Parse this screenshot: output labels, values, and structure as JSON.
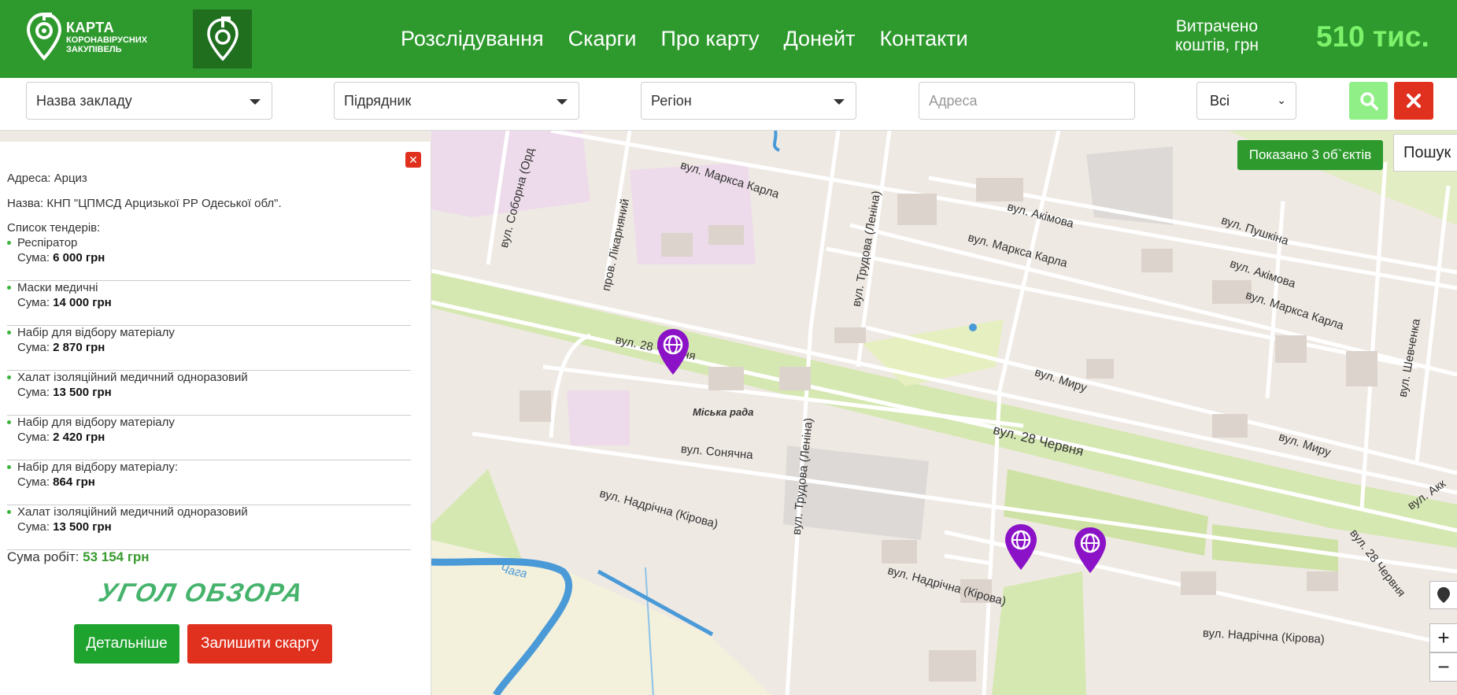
{
  "header": {
    "logo": {
      "line1": "КАРТА",
      "line2": "КОРОНАВІРУСНИХ",
      "line3": "ЗАКУПІВЕЛЬ"
    },
    "nav": [
      "Розслідування",
      "Скарги",
      "Про карту",
      "Донейт",
      "Контакти"
    ],
    "spent_label": "Витрачено коштів, грн",
    "spent_value": "510 тис.",
    "spent_color": "#7df26b",
    "accent": "#2e9a2e"
  },
  "filters": {
    "institution": "Назва закладу",
    "contractor": "Підрядник",
    "region": "Регіон",
    "address_placeholder": "Адреса",
    "type": "Всі",
    "search_icon": "search-icon",
    "clear_icon": "close-icon"
  },
  "map": {
    "shown_badge": "Показано 3 об`єктів",
    "search_tab": "Пошук",
    "city_hall": "Міська рада",
    "streets": {
      "marksa1": "вул. Маркса Карла",
      "marksa2": "вул. Маркса Карла",
      "marksa3": "вул. Маркса Карла",
      "akimova1": "вул. Акімова",
      "akimova2": "вул. Акімова",
      "pushkina": "вул. Пушкіна",
      "soborna": "вул. Соборна (Орд",
      "likarnianyi": "пров. Лікарняний",
      "trudova1": "вул. Трудова (Леніна)",
      "trudova2": "вул. Трудова (Леніна)",
      "chervnia1": "вул. 28 Червня",
      "chervnia2": "вул. 28 Червня",
      "chervnia3": "вул. 28 Червня",
      "myru1": "вул. Миру",
      "myru2": "вул. Миру",
      "soniachna": "вул. Сонячна",
      "nadrichna1": "вул. Надрічна (Кірова)",
      "nadrichna2": "вул. Надрічна (Кірова)",
      "nadrichna3": "вул. Надрічна (Кірова)",
      "shevchenka": "вул. Шевченка",
      "chaha": "Чага",
      "akk": "вул. Акк"
    },
    "zoom_in": "+",
    "zoom_out": "−",
    "locate_icon": "location-pin-icon",
    "marker_color": "#8b12c7",
    "marker_icon": "globe-icon"
  },
  "panel": {
    "address": "Адреса: Арциз",
    "name": "Назва: КНП \"ЦПМСД Арцизької РР Одеської обл\".",
    "list_title": "Список тендерів:",
    "sum_label": "Сума:",
    "tenders": [
      {
        "name": "Респіратор",
        "sum": "6 000 грн"
      },
      {
        "name": "Маски медичні",
        "sum": "14 000 грн"
      },
      {
        "name": "Набір для відбору матеріалу",
        "sum": "2 870 грн"
      },
      {
        "name": "Халат ізоляційний медичний одноразовий",
        "sum": "13 500 грн"
      },
      {
        "name": "Набір для відбору матеріалу",
        "sum": "2 420 грн"
      },
      {
        "name": "Набір для відбору матеріалу:",
        "sum": "864 грн"
      },
      {
        "name": "Халат ізоляційний медичний одноразовий",
        "sum": "13 500 грн"
      }
    ],
    "total_label": "Сума робіт:",
    "total_value": "53 154 грн",
    "brand": "УГОЛ ОБЗОРА",
    "details_button": "Детальніше",
    "complain_button": "Залишити скаргу"
  }
}
